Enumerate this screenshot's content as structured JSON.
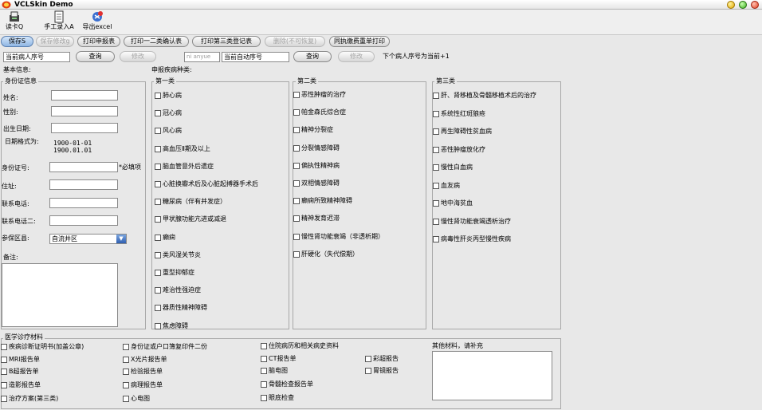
{
  "window": {
    "title": "VCLSkin Demo"
  },
  "toolbar": {
    "read_card": "读卡Q",
    "manual_entry": "手工录入A",
    "export_excel": "导出excel"
  },
  "tabs": [
    {
      "label": "保存S",
      "state": "active"
    },
    {
      "label": "保存修改g",
      "state": "disabled"
    },
    {
      "label": "打印申报表",
      "state": "normal"
    },
    {
      "label": "打印一二类确认表",
      "state": "normal"
    },
    {
      "label": "打印第三类登记表",
      "state": "normal"
    },
    {
      "label": "删除(不可恢复)",
      "state": "disabled"
    },
    {
      "label": "同执缴费重单打印",
      "state": "normal"
    }
  ],
  "search": {
    "patient_field": "当前病人序号",
    "query_label": "查询",
    "modify_label": "修改",
    "pinyin_placeholder": "ni anyue",
    "auto_seq_field": "当前自动序号",
    "next_patient_text": "下个病人序号为当前+1"
  },
  "basic_info": {
    "heading": "基本信息:",
    "id_group_title": "身份证信息",
    "name_label": "姓名:",
    "gender_label": "性别:",
    "birth_label": "出生日期:",
    "date_format_label": "日期格式为:",
    "date_format_example1": "1900-01-01",
    "date_format_example2": "1900.01.01",
    "id_number_label": "身份证号:",
    "required_hint": "*必填项",
    "address_label": "住址:",
    "phone_label": "联系电话:",
    "phone2_label": "联系电话二:",
    "district_label": "参保区县:",
    "district_value": "自流井区",
    "notes_label": "备注:"
  },
  "disease": {
    "heading": "申报疾病种类:",
    "cat1": {
      "title": "第一类",
      "items": [
        "肺心病",
        "冠心病",
        "风心病",
        "高血压Ⅱ期及以上",
        "脑血管意外后遗症",
        "心脏换瓣术后及心脏起搏器手术后",
        "糖尿病（伴有并发症）",
        "甲状腺功能亢进或减退",
        "癫痫",
        "类风湿关节炎",
        "重型抑郁症",
        "难治性强迫症",
        "器质性精神障碍",
        "焦虑障碍"
      ]
    },
    "cat2": {
      "title": "第二类",
      "items": [
        "恶性肿瘤的治疗",
        "帕金森氏综合症",
        "精神分裂症",
        "分裂情感障碍",
        "偏执性精神病",
        "双相情感障碍",
        "癫痫所致精神障碍",
        "精神发育迟滞",
        "慢性肾功能衰竭（非透析期）",
        "肝硬化（失代偿期）"
      ]
    },
    "cat3": {
      "title": "第三类",
      "items": [
        "肝、肾移植及骨髓移植术后的治疗",
        "系统性红斑狼疮",
        "再生障碍性贫血病",
        "恶性肿瘤放化疗",
        "慢性白血病",
        "血友病",
        "地中海贫血",
        "慢性肾功能衰竭透析治疗",
        "病毒性肝炎丙型慢性疾病"
      ]
    }
  },
  "materials": {
    "title": "医学诊疗材料",
    "col1": [
      "疾病诊断证明书(加盖公章)",
      "MRI报告单",
      "B超报告单",
      "造影报告单",
      "治疗方案(第三类)"
    ],
    "col2": [
      "身份证或户口簿复印件二份",
      "X光片报告单",
      "检验报告单",
      "病理报告单",
      "心电图"
    ],
    "col3": [
      "住院病历和相关病史资料",
      "CT报告单",
      "脑电图",
      "骨髓检查报告单",
      "眼底检查"
    ],
    "col4": [
      "彩超报告",
      "胃镜报告"
    ],
    "other_label": "其他材料，请补充"
  }
}
